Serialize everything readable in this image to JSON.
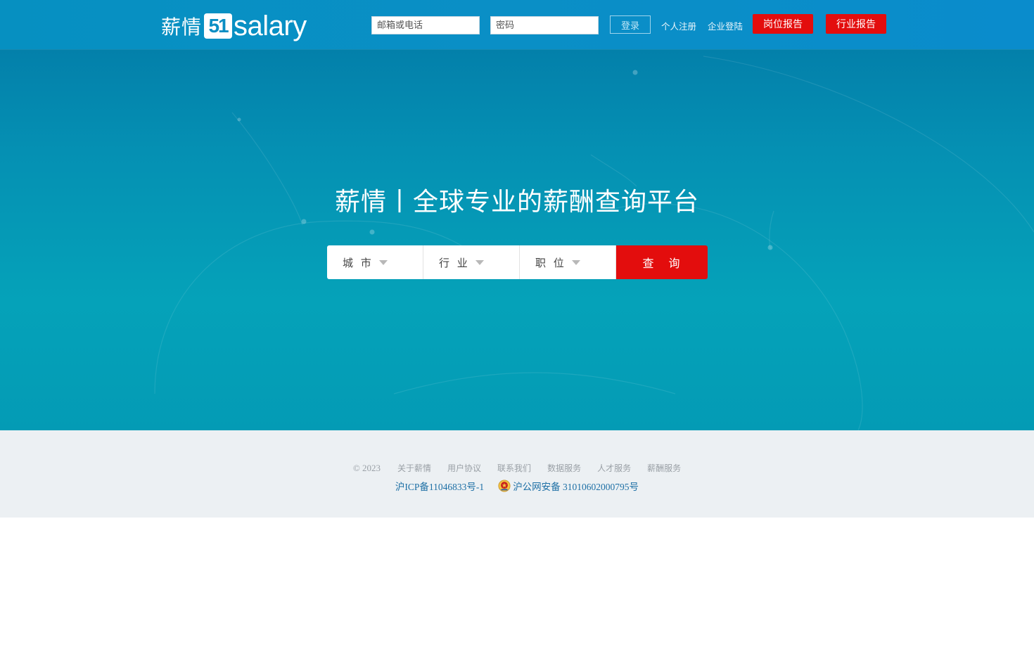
{
  "header": {
    "logo_cn": "薪情",
    "logo_num": "51",
    "logo_en": "salary",
    "email_placeholder": "邮箱或电话",
    "password_placeholder": "密码",
    "login_label": "登录",
    "register_label": "个人注册",
    "corp_login_label": "企业登陆",
    "job_report_label": "岗位报告",
    "industry_report_label": "行业报告"
  },
  "banner": {
    "slogan": "薪情丨全球专业的薪酬查询平台",
    "city_label": "城 市",
    "industry_label": "行 业",
    "position_label": "职 位",
    "search_label": "查 询"
  },
  "footer": {
    "copyright": "© 2023",
    "links": [
      "关于薪情",
      "用户协议",
      "联系我们",
      "数据服务",
      "人才服务",
      "薪酬服务"
    ],
    "icp": "沪ICP备11046833号-1",
    "police": "沪公网安备 31010602000795号"
  },
  "colors": {
    "header_bg": "#0a8ec4",
    "accent_red": "#e30d0d",
    "footer_bg": "#ecf0f3",
    "link_blue": "#1d6fa5"
  },
  "icons": [
    "dropdown-arrow-icon",
    "police-badge-icon"
  ]
}
